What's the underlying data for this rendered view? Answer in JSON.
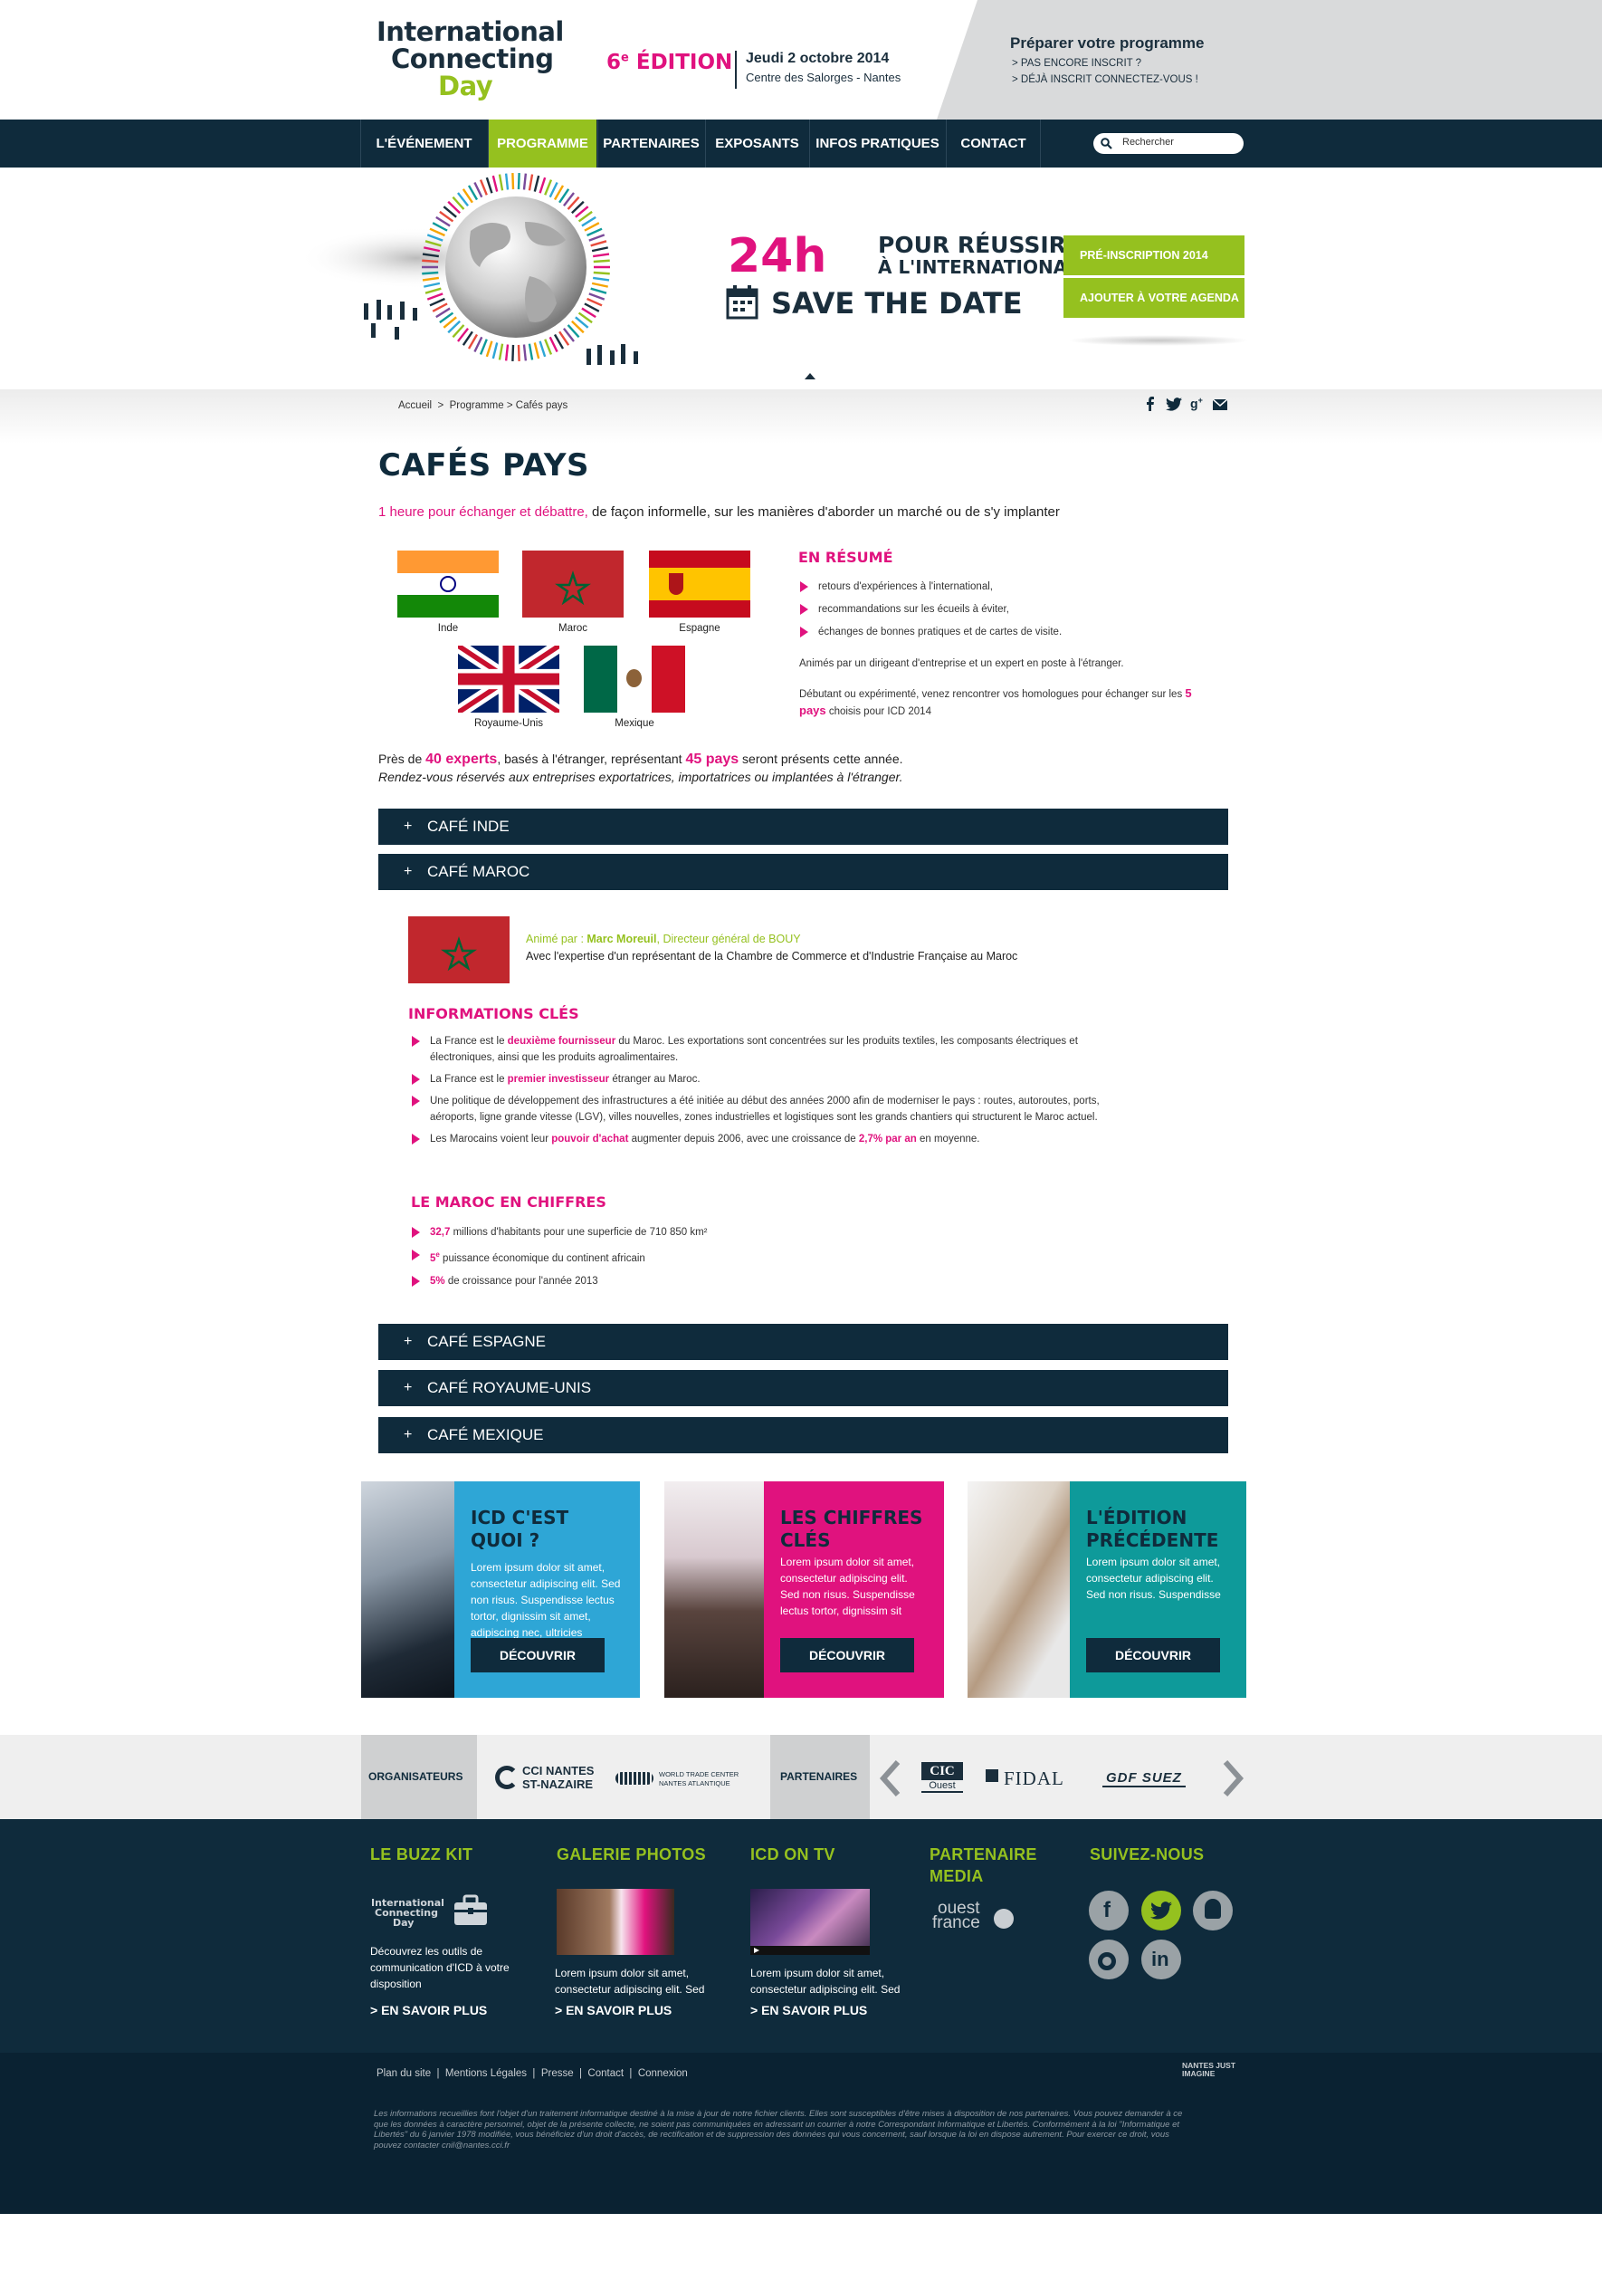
{
  "header": {
    "logo_line1": "International",
    "logo_line2": "Connecting",
    "logo_line3": "Day",
    "edition_num": "6",
    "edition_sup": "e",
    "edition_label": "ÉDITION",
    "date": "Jeudi 2 octobre 2014",
    "venue": "Centre des Salorges - Nantes",
    "prep_title": "Préparer votre programme",
    "prep_link1": "> PAS ENCORE INSCRIT ?",
    "prep_link2": "> DÉJÀ INSCRIT CONNECTEZ-VOUS !"
  },
  "nav": {
    "items": [
      "L'ÉVÉNEMENT",
      "PROGRAMME",
      "PARTENAIRES",
      "EXPOSANTS",
      "INFOS PRATIQUES",
      "CONTACT"
    ],
    "search_placeholder": "Rechercher"
  },
  "banner": {
    "big": "24h",
    "line1": "POUR RÉUSSIR",
    "line2": "À L'INTERNATIONAL",
    "save": "SAVE THE DATE",
    "btn1": "PRÉ-INSCRIPTION 2014",
    "btn2": "AJOUTER À VOTRE AGENDA"
  },
  "breadcrumb": [
    "Accueil",
    "Programme",
    "Cafés pays"
  ],
  "breadcrumb_sep": ">",
  "page": {
    "title": "CAFÉS PAYS",
    "intro_pink": "1 heure pour échanger et débattre,",
    "intro_rest": " de façon informelle, sur les manières d'aborder un marché ou de s'y implanter"
  },
  "flags": [
    "Inde",
    "Maroc",
    "Espagne",
    "Royaume-Unis",
    "Mexique"
  ],
  "resume": {
    "title": "EN RÉSUMÉ",
    "items": [
      "retours d'expériences à l'international,",
      "recommandations sur les écueils à éviter,",
      "échanges de bonnes pratiques et de cartes de visite."
    ],
    "p1": "Animés par un dirigeant d'entreprise et un expert en poste à l'étranger.",
    "p2a": "Débutant ou expérimenté, venez rencontrer vos homologues pour échanger sur les ",
    "p2b": "5 pays",
    "p2c": " choisis pour ICD 2014"
  },
  "stats": {
    "s1": "Près de ",
    "s2": "40 experts",
    "s3": ", basés à l'étranger, représentant ",
    "s4": "45 pays",
    "s5": " seront présents cette année.",
    "italic": "Rendez-vous réservés aux entreprises exportatrices, importatrices ou implantées à l'étranger."
  },
  "accordion": {
    "plus": "+",
    "items": [
      "CAFÉ INDE",
      "CAFÉ MAROC",
      "CAFÉ ESPAGNE",
      "CAFÉ ROYAUME-UNIS",
      "CAFÉ MEXIQUE"
    ]
  },
  "maroc": {
    "anime_label": "Animé par  :  ",
    "anime_name": "Marc Moreuil",
    "anime_role": ", Directeur général de BOUY",
    "expertise": "Avec l'expertise d'un représentant de la Chambre de Commerce et d'Industrie Française au Maroc",
    "info_title": "INFORMATIONS CLÉS",
    "b1a": "La France est le ",
    "b1b": "deuxième fournisseur",
    "b1c": " du Maroc. Les exportations sont concentrées sur les produits textiles, les composants électriques et électroniques, ainsi que les produits agroalimentaires.",
    "b2a": "La France est le ",
    "b2b": "premier investisseur",
    "b2c": " étranger au Maroc.",
    "b3": "Une politique de développement des infrastructures a été initiée au début des années 2000 afin de moderniser le pays  : routes, autoroutes, ports, aéroports, ligne grande vitesse (LGV), villes nouvelles, zones industrielles et logistiques sont les grands chantiers qui structurent le Maroc actuel.",
    "b4a": "Les Marocains voient leur ",
    "b4b": "pouvoir d'achat",
    "b4c": " augmenter depuis 2006, avec une croissance de ",
    "b4d": "2,7% par an",
    "b4e": " en moyenne.",
    "fig_title": "LE MAROC EN CHIFFRES",
    "f1a": "32,7",
    "f1b": " millions d'habitants pour une superficie de 710  850 km²",
    "f2a": "5",
    "f2sup": "e",
    "f2b": " puissance économique du continent africain",
    "f3a": "5%",
    "f3b": " de croissance pour l'année 2013"
  },
  "cards": [
    {
      "title1": "ICD C'EST QUOI ?",
      "title2": "",
      "text": "Lorem ipsum dolor sit amet, consectetur adipiscing elit. Sed non risus. Suspendisse lectus tortor, dignissim sit amet, adipiscing nec, ultricies",
      "btn": "DÉCOUVRIR"
    },
    {
      "title1": "LES CHIFFRES",
      "title2": "CLÉS",
      "text": "Lorem ipsum dolor sit amet, consectetur adipiscing elit. Sed non risus. Suspendisse lectus tortor, dignissim sit",
      "btn": "DÉCOUVRIR"
    },
    {
      "title1": "L'ÉDITION",
      "title2": "PRÉCÉDENTE",
      "text": "Lorem ipsum dolor sit amet, consectetur adipiscing elit. Sed non risus. Suspendisse",
      "btn": "DÉCOUVRIR"
    }
  ],
  "partners": {
    "organisateurs": "ORGANISATEURS",
    "cci1": "CCI NANTES",
    "cci2": "ST-NAZAIRE",
    "wtc1": "WORLD TRADE CENTER",
    "wtc2": "NANTES ATLANTIQUE",
    "partenaires": "PARTENAIRES",
    "cic": "CIC",
    "cic_sub": "Ouest",
    "fidal": "FIDAL",
    "gdf": "GDF SUEZ"
  },
  "footer": {
    "buzz_title": "LE BUZZ KIT",
    "buzz_logo1": "International",
    "buzz_logo2": "Connecting",
    "buzz_logo3": "Day",
    "buzz_text": "Découvrez les outils de communication d'ICD à votre disposition",
    "buzz_more": "> EN SAVOIR PLUS",
    "gal_title": "GALERIE PHOTOS",
    "gal_text": "Lorem ipsum dolor sit amet, consectetur adipiscing elit. Sed",
    "gal_more": "> EN SAVOIR PLUS",
    "tv_title": "ICD ON TV",
    "tv_text": "Lorem ipsum dolor sit amet, consectetur adipiscing elit. Sed",
    "tv_more": "> EN SAVOIR PLUS",
    "media_title1": "PARTENAIRE",
    "media_title2": "MEDIA",
    "media_logo1": "ouest",
    "media_logo2": "france",
    "social_title": "SUIVEZ-NOUS",
    "links": [
      "Plan du site",
      "Mentions Légales",
      "Presse",
      "Contact",
      "Connexion"
    ],
    "nantes": "NANTES JUST IMAGINE",
    "legal": "Les informations recueillies font l'objet d'un traitement informatique destiné à la mise à jour de notre fichier clients. Elles sont susceptibles d'être mises à disposition de nos partenaires. Vous pouvez demander à ce que les données à caractère personnel, objet de la présente collecte, ne soient pas communiquées en adressant un courrier à notre Correspondant Informatique et Libertés. Conformément à la loi \"Informatique et Libertés\" du 6 janvier 1978 modifiée, vous bénéficiez d'un droit d'accès, de rectification et de suppression des données qui vous concernent, sauf lorsque la loi en dispose autrement. Pour exercer ce droit, vous pouvez contacter cnil@nantes.cci.fr"
  },
  "colors": {
    "navy": "#0f2b3c",
    "green": "#95c11f",
    "pink": "#e0127e",
    "blue": "#2ea6d6",
    "teal": "#0e9a9a"
  }
}
